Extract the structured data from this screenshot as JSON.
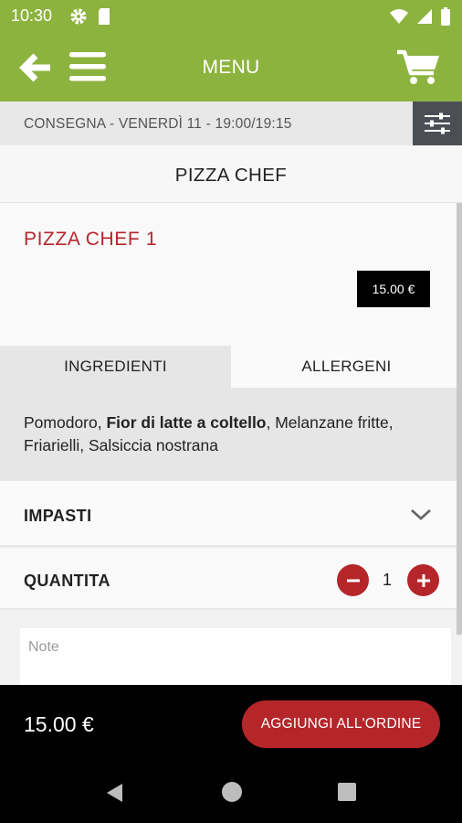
{
  "status_bar": {
    "time": "10:30",
    "left_icons": [
      "gear-icon",
      "sim-card-icon"
    ],
    "right_icons": [
      "wifi-icon",
      "signal-icon",
      "battery-icon"
    ]
  },
  "app_bar": {
    "title": "MENU",
    "icons": [
      "arrow-left-icon",
      "hamburger-menu-icon",
      "shopping-cart-icon"
    ],
    "color": "#8cb33e"
  },
  "delivery": {
    "text": "CONSEGNA - VENERDÌ 11 - 19:00/19:15",
    "filter_icon": "sliders-icon"
  },
  "page": {
    "title": "PIZZA CHEF"
  },
  "product": {
    "name": "PIZZA CHEF 1",
    "price": "15.00 €",
    "name_color": "#b5262b"
  },
  "tabs": [
    {
      "label": "INGREDIENTI",
      "active": true
    },
    {
      "label": "ALLERGENI",
      "active": false
    }
  ],
  "ingredients": {
    "part1": "Pomodoro, ",
    "bold": "Fior di latte a coltello",
    "part2": ", Melanzane fritte, Friarielli, Salsiccia nostrana"
  },
  "options": {
    "impasti_label": "IMPASTI",
    "impasti_icon": "chevron-down-icon",
    "quantity_label": "QUANTITA",
    "quantity": "1"
  },
  "note": {
    "placeholder": "Note",
    "value": ""
  },
  "footer": {
    "total": "15.00 €",
    "add_button_label": "AGGIUNGI ALL'ORDINE",
    "button_color": "#b5262b"
  },
  "nav": {
    "icons": [
      "nav-back-icon",
      "nav-home-icon",
      "nav-recents-icon"
    ]
  }
}
